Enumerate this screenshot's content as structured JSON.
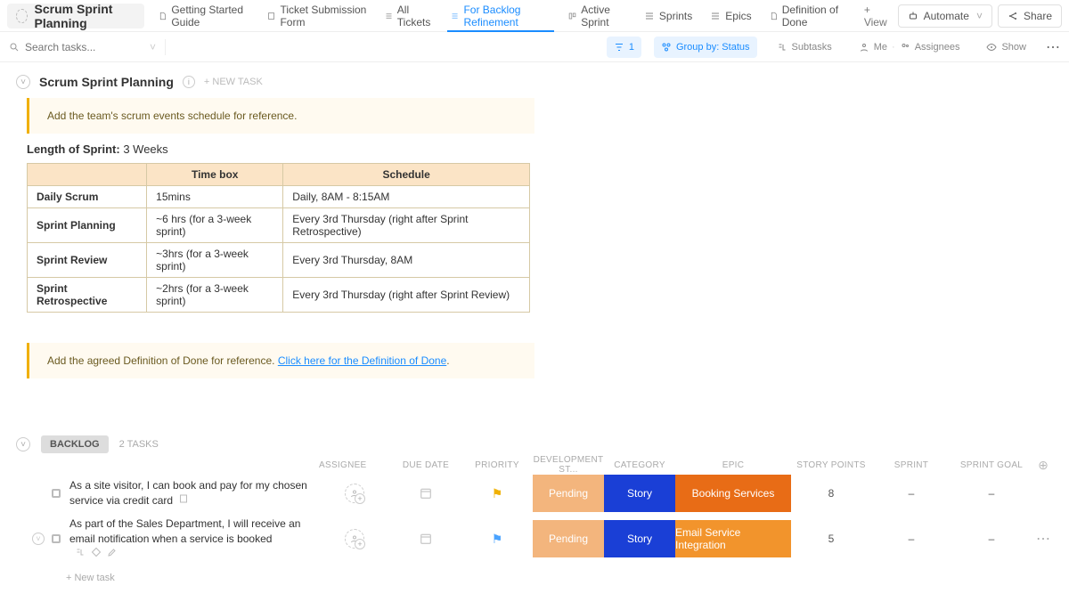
{
  "header": {
    "title": "Scrum Sprint Planning",
    "tabs": [
      {
        "label": "Getting Started Guide"
      },
      {
        "label": "Ticket Submission Form"
      },
      {
        "label": "All Tickets"
      },
      {
        "label": "For Backlog Refinement",
        "active": true
      },
      {
        "label": "Active Sprint"
      },
      {
        "label": "Sprints"
      },
      {
        "label": "Epics"
      },
      {
        "label": "Definition of Done"
      }
    ],
    "add_view": "+ View",
    "automate": "Automate",
    "share": "Share"
  },
  "subbar": {
    "search_placeholder": "Search tasks...",
    "filter_count": "1",
    "group_label": "Group by: Status",
    "subtasks": "Subtasks",
    "me": "Me",
    "assignees": "Assignees",
    "show": "Show"
  },
  "list": {
    "title": "Scrum Sprint Planning",
    "new_task": "+ NEW TASK",
    "note1": "Add the team's scrum events schedule for reference.",
    "length_label": "Length of Sprint:",
    "length_value": "3 Weeks",
    "table": {
      "head_timebox": "Time box",
      "head_schedule": "Schedule",
      "rows": [
        {
          "name": "Daily Scrum",
          "timebox": "15mins",
          "schedule": "Daily, 8AM - 8:15AM"
        },
        {
          "name": "Sprint Planning",
          "timebox": "~6 hrs (for a 3-week sprint)",
          "schedule": "Every 3rd Thursday (right after Sprint Retrospective)"
        },
        {
          "name": "Sprint Review",
          "timebox": "~3hrs (for a 3-week sprint)",
          "schedule": "Every 3rd Thursday, 8AM"
        },
        {
          "name": "Sprint Retrospective",
          "timebox": "~2hrs (for a 3-week sprint)",
          "schedule": "Every 3rd Thursday (right after Sprint Review)"
        }
      ]
    },
    "note2_text": "Add the agreed Definition of Done for reference. ",
    "note2_link": "Click here for the Definition of Done"
  },
  "group": {
    "name": "BACKLOG",
    "count": "2 TASKS",
    "cols": {
      "assignee": "ASSIGNEE",
      "due": "DUE DATE",
      "priority": "PRIORITY",
      "dev": "DEVELOPMENT ST...",
      "category": "CATEGORY",
      "epic": "EPIC",
      "points": "STORY POINTS",
      "sprint": "SPRINT",
      "goal": "SPRINT GOAL"
    },
    "rows": [
      {
        "title": "As a site visitor, I can book and pay for my chosen service via credit card",
        "pending": "Pending",
        "category": "Story",
        "epic": "Booking Services",
        "points": "8",
        "sprint": "–",
        "goal": "–",
        "flag": "yellow"
      },
      {
        "title": "As part of the Sales Department, I will receive an email notification when a service is booked",
        "pending": "Pending",
        "category": "Story",
        "epic": "Email Service Integration",
        "points": "5",
        "sprint": "–",
        "goal": "–",
        "flag": "blue"
      }
    ],
    "new_task": "+ New task"
  }
}
